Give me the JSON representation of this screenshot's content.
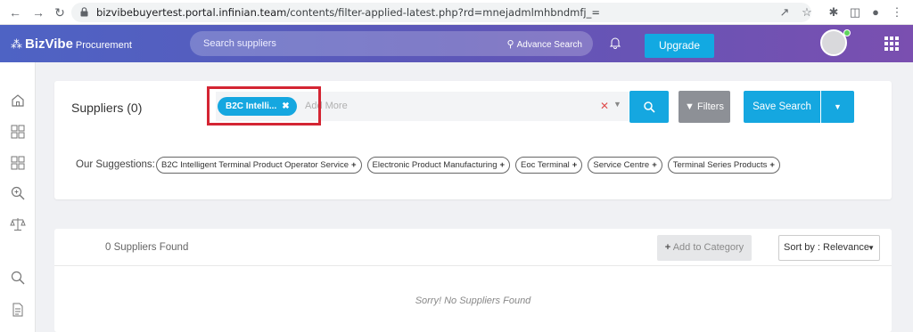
{
  "browser": {
    "url_host": "bizvibebuyertest.portal.infinian.team",
    "url_path": "/contents/filter-applied-latest.php?rd=mnejadmlmhbndmfj_="
  },
  "header": {
    "logo_name": "BizVibe",
    "logo_sub": "Procurement",
    "search_placeholder": "Search suppliers",
    "advance_search_label": "Advance Search",
    "upgrade_label": "Upgrade"
  },
  "search_card": {
    "title": "Suppliers (0)",
    "chip_label": "B2C Intelli...",
    "add_more_placeholder": "Add More",
    "filters_label": "Filters",
    "save_search_label": "Save Search",
    "suggestions_label": "Our Suggestions:",
    "suggestions": [
      "B2C Intelligent Terminal Product Operator Service",
      "Electronic Product Manufacturing",
      "Eoc Terminal",
      "Service Centre",
      "Terminal Series Products"
    ]
  },
  "results_card": {
    "found_text": "0 Suppliers Found",
    "add_to_category_label": "Add to Category",
    "sort_label": "Sort by : Relevance",
    "empty_message": "Sorry! No Suppliers Found"
  },
  "colors": {
    "accent": "#15a7e0",
    "highlight": "#d42533"
  }
}
